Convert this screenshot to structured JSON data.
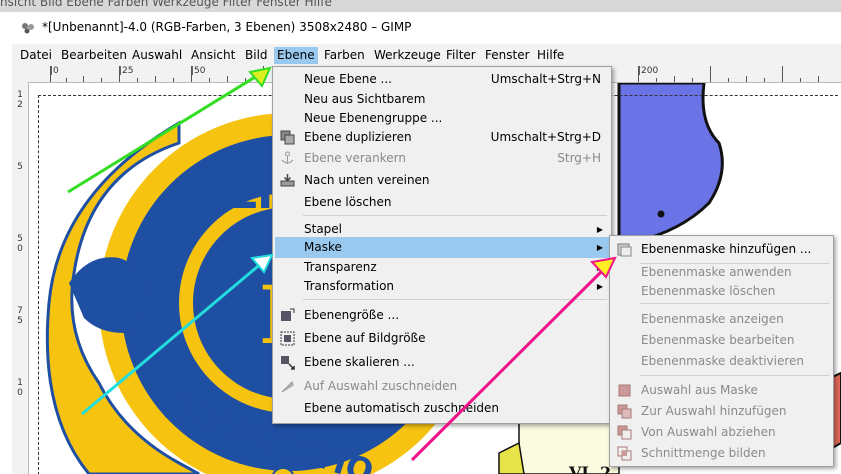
{
  "background_strip": {
    "text": "nsicht   Bild   Ebene   Farben   Werkzeuge   Filter   Fenster   Hilfe"
  },
  "window": {
    "title": "*[Unbenannt]-4.0 (RGB-Farben, 3 Ebenen) 3508x2480 – GIMP"
  },
  "menubar": {
    "items": [
      {
        "label": "Datei"
      },
      {
        "label": "Bearbeiten"
      },
      {
        "label": "Auswahl"
      },
      {
        "label": "Ansicht"
      },
      {
        "label": "Bild"
      },
      {
        "label": "Ebene"
      },
      {
        "label": "Farben"
      },
      {
        "label": "Werkzeuge"
      },
      {
        "label": "Filter"
      },
      {
        "label": "Fenster"
      },
      {
        "label": "Hilfe"
      }
    ]
  },
  "rulers": {
    "h_labels": [
      "|0",
      "|25",
      "|50",
      "|200"
    ],
    "v_labels": [
      "1",
      "2",
      "5",
      "5",
      "0",
      "7",
      "5",
      "1",
      "0"
    ]
  },
  "canvas": {
    "logo_text_top": "LIO",
    "logo_text_bottom": "INTERNATIO",
    "logo_letter": "L",
    "registered": "®",
    "map_label": "VI, 2"
  },
  "layer_menu": {
    "items": [
      {
        "label": "Neue Ebene ...",
        "shortcut": "Umschalt+Strg+N",
        "icon": "none",
        "disabled": false
      },
      {
        "label": "Neu aus Sichtbarem",
        "shortcut": "",
        "icon": "none",
        "disabled": false
      },
      {
        "label": "Neue Ebenengruppe ...",
        "shortcut": "",
        "icon": "none",
        "disabled": false
      },
      {
        "label": "Ebene duplizieren",
        "shortcut": "Umschalt+Strg+D",
        "icon": "duplicate-layer-icon",
        "disabled": false
      },
      {
        "label": "Ebene verankern",
        "shortcut": "Strg+H",
        "icon": "anchor-icon",
        "disabled": true
      },
      {
        "label": "Nach unten vereinen",
        "shortcut": "",
        "icon": "merge-down-icon",
        "disabled": false
      },
      {
        "label": "Ebene löschen",
        "shortcut": "",
        "icon": "none",
        "disabled": false
      },
      {
        "label": "Stapel",
        "shortcut": "",
        "icon": "none",
        "disabled": false,
        "submenu": true
      },
      {
        "label": "Maske",
        "shortcut": "",
        "icon": "none",
        "disabled": false,
        "submenu": true,
        "highlighted": true
      },
      {
        "label": "Transparenz",
        "shortcut": "",
        "icon": "none",
        "disabled": false,
        "submenu": true
      },
      {
        "label": "Transformation",
        "shortcut": "",
        "icon": "none",
        "disabled": false,
        "submenu": true
      },
      {
        "label": "Ebenengröße ...",
        "shortcut": "",
        "icon": "layer-size-icon",
        "disabled": false
      },
      {
        "label": "Ebene auf Bildgröße",
        "shortcut": "",
        "icon": "layer-to-image-size-icon",
        "disabled": false
      },
      {
        "label": "Ebene skalieren ...",
        "shortcut": "",
        "icon": "scale-layer-icon",
        "disabled": false
      },
      {
        "label": "Auf Auswahl zuschneiden",
        "shortcut": "",
        "icon": "crop-to-selection-icon",
        "disabled": true
      },
      {
        "label": "Ebene automatisch zuschneiden",
        "shortcut": "",
        "icon": "none",
        "disabled": false
      }
    ]
  },
  "mask_menu": {
    "items": [
      {
        "label": "Ebenenmaske hinzufügen ...",
        "icon": "add-mask-icon",
        "disabled": false
      },
      {
        "label": "Ebenenmaske anwenden",
        "icon": "none",
        "disabled": true
      },
      {
        "label": "Ebenenmaske löschen",
        "icon": "none",
        "disabled": true
      },
      {
        "label": "Ebenenmaske anzeigen",
        "icon": "none",
        "disabled": true
      },
      {
        "label": "Ebenenmaske bearbeiten",
        "icon": "none",
        "disabled": true
      },
      {
        "label": "Ebenenmaske deaktivieren",
        "icon": "none",
        "disabled": true
      },
      {
        "label": "Auswahl aus Maske",
        "icon": "mask-to-selection-icon",
        "disabled": true
      },
      {
        "label": "Zur Auswahl hinzufügen",
        "icon": "add-to-selection-icon",
        "disabled": true
      },
      {
        "label": "Von Auswahl abziehen",
        "icon": "subtract-from-selection-icon",
        "disabled": true
      },
      {
        "label": "Schnittmenge bilden",
        "icon": "intersect-selection-icon",
        "disabled": true
      }
    ]
  },
  "colors": {
    "highlight": "#99c9ef",
    "lions_blue": "#1f4fa3",
    "lions_yellow": "#f7c311",
    "map_blue": "#6b74e6",
    "arrow_green": "#33dd22",
    "arrow_cyan": "#22dddd",
    "arrow_magenta": "#ee1188"
  }
}
